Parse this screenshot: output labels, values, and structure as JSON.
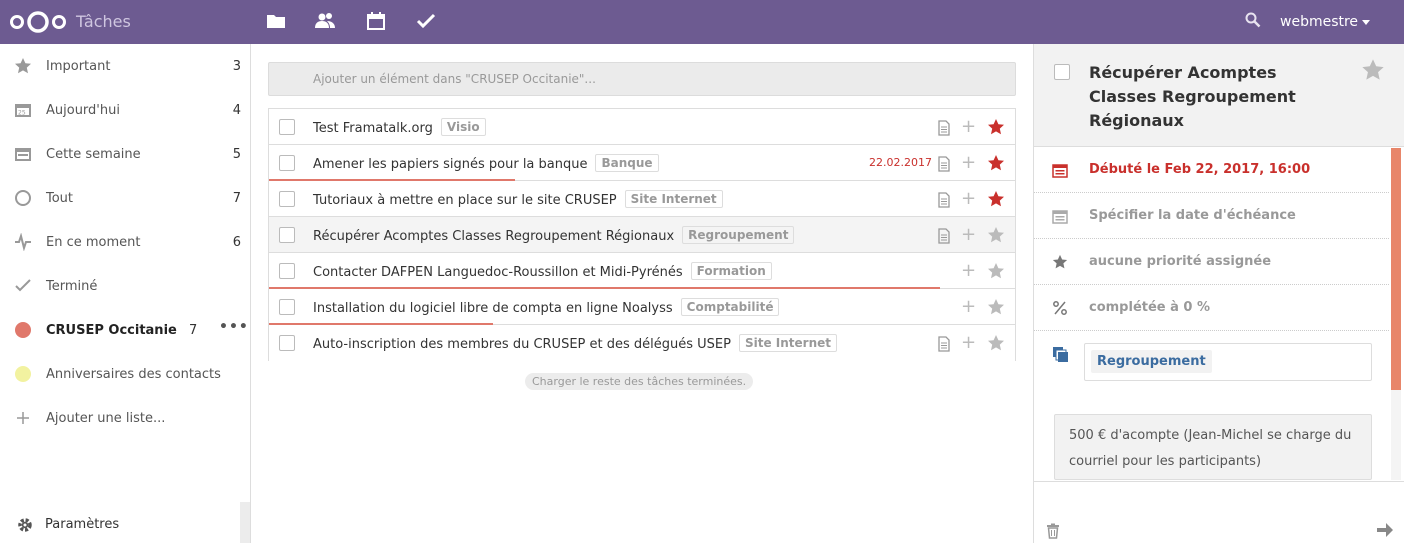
{
  "colors": {
    "header_bg": "#6d5b91",
    "accent_red": "#c9302c",
    "progress": "#e0786b",
    "list_crusep": "#e0786b",
    "list_birthdays": "#f2f2a0",
    "tag_blue": "#3b6ca0"
  },
  "header": {
    "app_name": "Tâches",
    "apps": [
      {
        "name": "files",
        "icon": "folder-icon"
      },
      {
        "name": "contacts",
        "icon": "contacts-icon"
      },
      {
        "name": "calendar",
        "icon": "calendar-icon"
      },
      {
        "name": "tasks",
        "icon": "checkmark-icon"
      }
    ],
    "user": "webmestre"
  },
  "sidebar": {
    "items": [
      {
        "label": "Important",
        "count": "3",
        "icon": "star-icon"
      },
      {
        "label": "Aujourd'hui",
        "count": "4",
        "icon": "calendar-today-icon"
      },
      {
        "label": "Cette semaine",
        "count": "5",
        "icon": "calendar-week-icon"
      },
      {
        "label": "Tout",
        "count": "7",
        "icon": "circle-icon"
      },
      {
        "label": "En ce moment",
        "count": "6",
        "icon": "pulse-icon"
      },
      {
        "label": "Terminé",
        "count": "",
        "icon": "checkmark-icon"
      }
    ],
    "lists": [
      {
        "label": "CRUSEP Occitanie",
        "count": "7",
        "menu": "•••"
      },
      {
        "label": "Anniversaires des contacts",
        "count": ""
      }
    ],
    "add_list": "Ajouter une liste...",
    "settings": "Paramètres"
  },
  "main": {
    "add_placeholder": "Ajouter un élément dans \"CRUSEP Occitanie\"...",
    "tasks": [
      {
        "title": "Test Framatalk.org",
        "tag": "Visio",
        "due": "",
        "note": true,
        "starred": true,
        "progress": 0
      },
      {
        "title": "Amener les papiers signés pour la banque",
        "tag": "Banque",
        "due": "22.02.2017",
        "note": true,
        "starred": true,
        "progress": 33
      },
      {
        "title": "Tutoriaux à mettre en place sur le site CRUSEP",
        "tag": "Site Internet",
        "due": "",
        "note": true,
        "starred": true,
        "progress": 0
      },
      {
        "title": "Récupérer Acomptes Classes Regroupement Régionaux",
        "tag": "Regroupement",
        "due": "",
        "note": true,
        "starred": false,
        "progress": 0,
        "selected": true
      },
      {
        "title": "Contacter DAFPEN Languedoc-Roussillon et Midi-Pyrénés",
        "tag": "Formation",
        "due": "",
        "note": false,
        "starred": false,
        "progress": 90
      },
      {
        "title": "Installation du logiciel libre de compta en ligne Noalyss",
        "tag": "Comptabilité",
        "due": "",
        "note": false,
        "starred": false,
        "progress": 30
      },
      {
        "title": "Auto-inscription des membres du CRUSEP et des délégués USEP",
        "tag": "Site Internet",
        "due": "",
        "note": true,
        "starred": false,
        "progress": 0
      }
    ],
    "load_more": "Charger le reste des tâches terminées."
  },
  "details": {
    "title": "Récupérer Acomptes Classes Regroupement Régionaux",
    "start": "Débuté le Feb 22, 2017, 16:00",
    "due": "Spécifier la date d'échéance",
    "priority": "aucune priorité assignée",
    "completion": "complétée à 0 %",
    "category": "Regroupement",
    "note": "500 € d'acompte (Jean-Michel se charge du courriel pour les participants)"
  }
}
